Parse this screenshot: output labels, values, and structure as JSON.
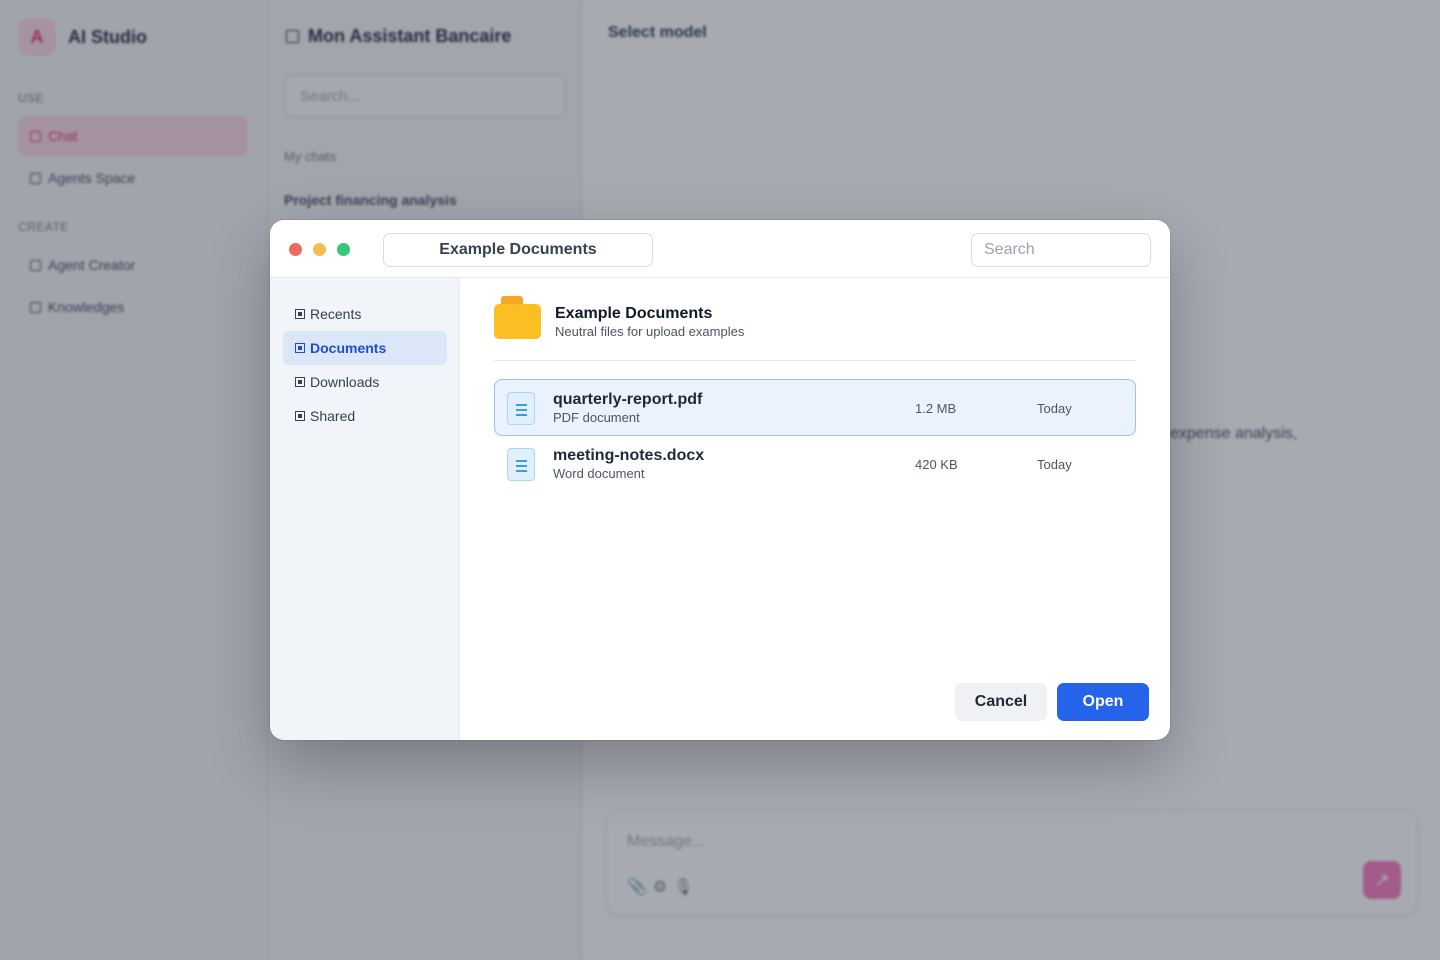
{
  "app": {
    "logo_letter": "A",
    "name": "AI Studio",
    "sections": {
      "use": "USE",
      "create": "CREATE"
    },
    "nav": [
      {
        "label": "Chat",
        "active": true
      },
      {
        "label": "Agents Space",
        "active": false
      },
      {
        "label": "Agent Creator",
        "active": false
      },
      {
        "label": "Knowledges",
        "active": false
      }
    ]
  },
  "chats_panel": {
    "title": "Mon Assistant Bancaire",
    "search_placeholder": "Search...",
    "section_label": "My chats",
    "items": [
      "Project financing analysis"
    ]
  },
  "main": {
    "select_model": "Select model",
    "partial_text": "expense analysis,",
    "composer_placeholder": "Message...",
    "tool_icons": [
      "paperclip-icon",
      "settings-icon",
      "microphone-icon"
    ],
    "send_icon": "arrow-up-right-icon"
  },
  "dialog": {
    "window_controls": {
      "close": "#ee6a5f",
      "minimize": "#f5bd4f",
      "maximize": "#34c77b"
    },
    "path": "Example Documents",
    "search_placeholder": "Search",
    "sidebar": [
      {
        "label": "Recents",
        "active": false
      },
      {
        "label": "Documents",
        "active": true
      },
      {
        "label": "Downloads",
        "active": false
      },
      {
        "label": "Shared",
        "active": false
      }
    ],
    "folder": {
      "title": "Example Documents",
      "subtitle": "Neutral files for upload examples"
    },
    "files": [
      {
        "name": "quarterly-report.pdf",
        "type": "PDF document",
        "size": "1.2 MB",
        "modified": "Today",
        "selected": true
      },
      {
        "name": "meeting-notes.docx",
        "type": "Word document",
        "size": "420 KB",
        "modified": "Today",
        "selected": false
      }
    ],
    "buttons": {
      "cancel": "Cancel",
      "open": "Open"
    }
  },
  "colors": {
    "accent_pink": "#db2777",
    "primary_blue": "#2563eb",
    "folder_yellow": "#fbbf24"
  }
}
